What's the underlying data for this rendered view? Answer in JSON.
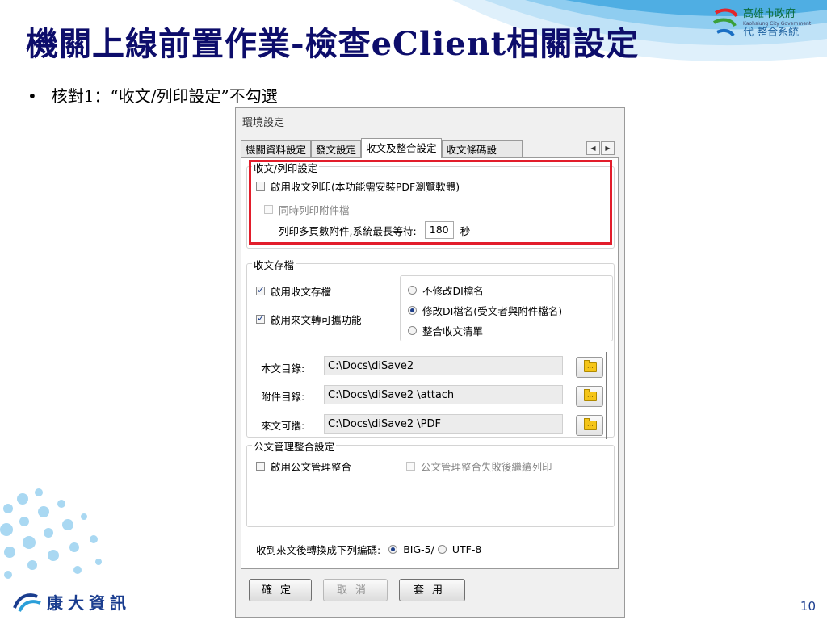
{
  "slide": {
    "title": "機關上線前置作業-檢查eClient相關設定",
    "bullet": "核對1：“收文/列印設定”不勾選",
    "page_number": "10"
  },
  "gov_logo": {
    "line1": "高雄市政府",
    "line2": "Kaohsiung City Government",
    "line3": "代  整合系統"
  },
  "company_logo": {
    "name": "康大資訊"
  },
  "dialog": {
    "title": "環境設定",
    "tabs": [
      {
        "label": "機關資料設定",
        "active": false
      },
      {
        "label": "發文設定",
        "active": false
      },
      {
        "label": "收文及整合設定",
        "active": true
      },
      {
        "label": "收文條碼設",
        "active": false
      }
    ],
    "print_group": {
      "title": "收文/列印設定",
      "enable_print": {
        "label": "啟用收文列印(本功能需安裝PDF瀏覽軟體)",
        "checked": false
      },
      "print_attachments": {
        "label": "同時列印附件檔",
        "checked": false,
        "enabled": false
      },
      "wait_label": "列印多頁數附件,系統最長等待:",
      "wait_value": "180",
      "wait_unit": "秒"
    },
    "archive_group": {
      "title": "收文存檔",
      "enable_archive": {
        "label": "啟用收文存檔",
        "checked": true
      },
      "enable_portable": {
        "label": "啟用來文轉可攜功能",
        "checked": true
      },
      "rename_options": [
        {
          "label": "不修改DI檔名",
          "selected": false
        },
        {
          "label": "修改DI檔名(受文者與附件檔名)",
          "selected": true
        },
        {
          "label": "整合收文清單",
          "selected": false
        }
      ],
      "paths": [
        {
          "label": "本文目錄:",
          "value": "C:\\Docs\\diSave2"
        },
        {
          "label": "附件目錄:",
          "value": "C:\\Docs\\diSave2 \\attach"
        },
        {
          "label": "來文可攜:",
          "value": "C:\\Docs\\diSave2 \\PDF"
        }
      ],
      "folder_button_text": "..."
    },
    "integration_group": {
      "title": "公文管理整合設定",
      "enable_integration": {
        "label": "啟用公文管理整合",
        "checked": false
      },
      "continue_print": {
        "label": "公文管理整合失敗後繼續列印",
        "checked": false,
        "enabled": false
      }
    },
    "encoding": {
      "label": "收到來文後轉換成下列編碼:",
      "options": [
        {
          "label": "BIG-5/",
          "selected": true
        },
        {
          "label": "UTF-8",
          "selected": false
        }
      ]
    },
    "buttons": {
      "ok": "確定",
      "cancel": "取消",
      "apply": "套用"
    }
  }
}
